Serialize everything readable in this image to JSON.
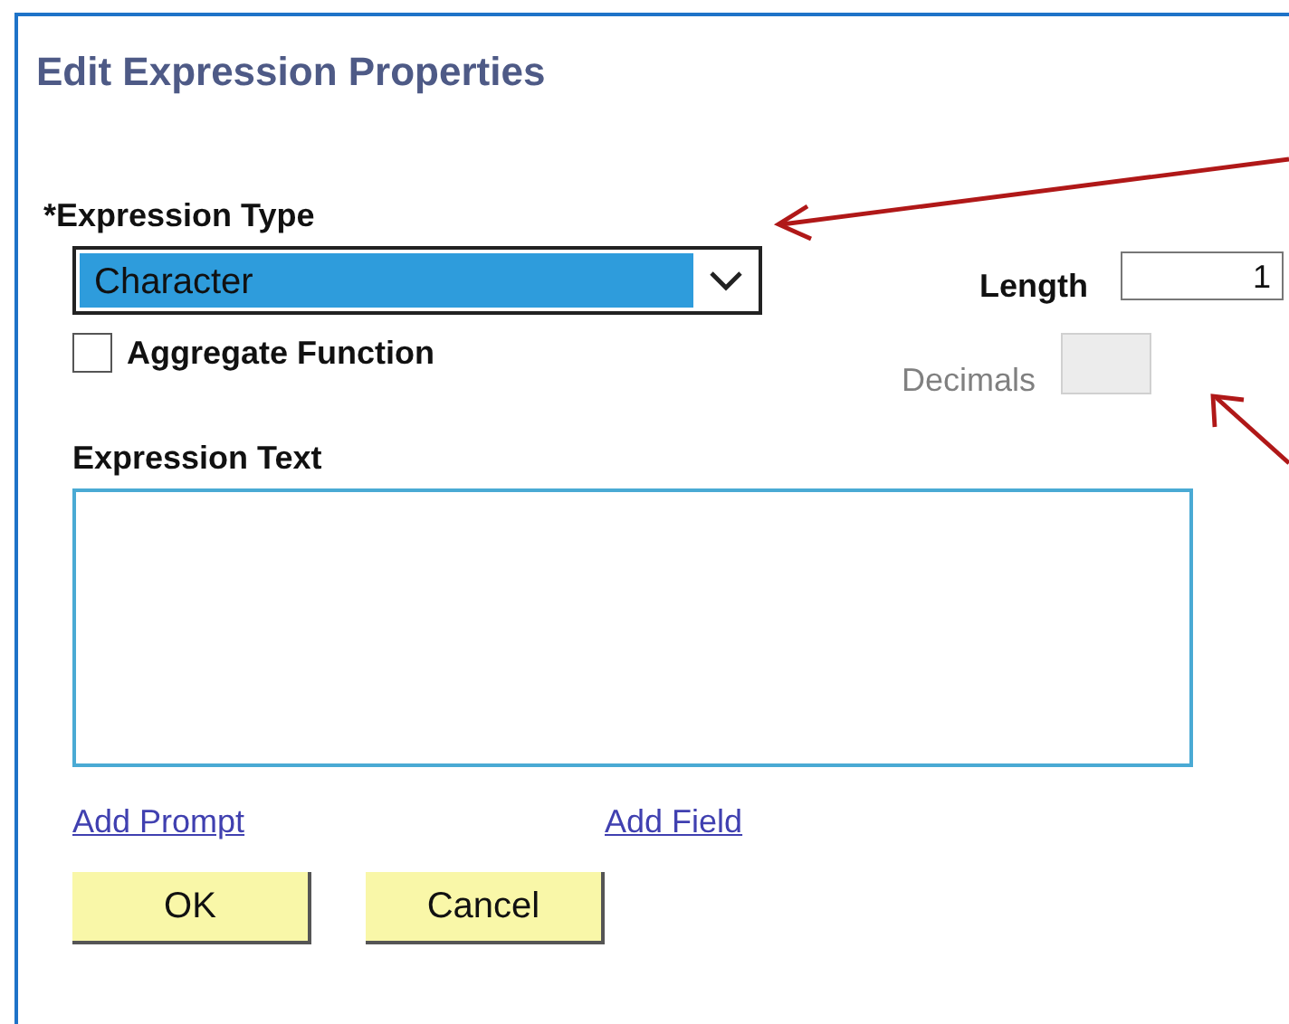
{
  "title": "Edit Expression Properties",
  "expression_type": {
    "label": "*Expression Type",
    "value": "Character"
  },
  "length": {
    "label": "Length",
    "value": "1"
  },
  "aggregate_function": {
    "label": "Aggregate Function",
    "checked": false
  },
  "decimals": {
    "label": "Decimals",
    "disabled": true
  },
  "expression_text": {
    "label": "Expression Text"
  },
  "links": [
    "Add Prompt",
    "Add Field"
  ],
  "buttons": [
    "OK",
    "Cancel"
  ]
}
